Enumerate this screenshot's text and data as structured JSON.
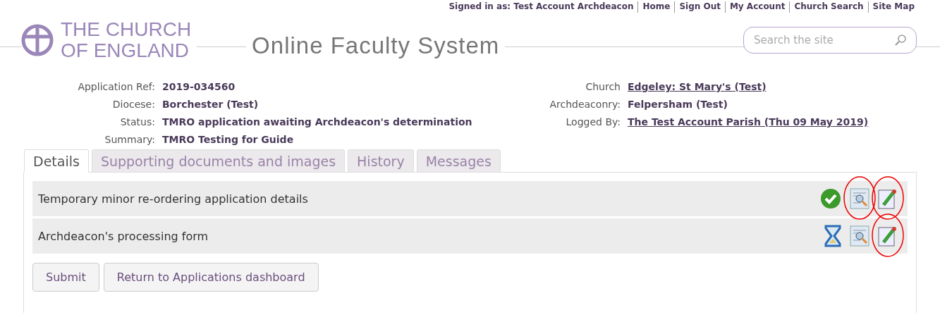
{
  "top_links": [
    "Signed in as: Test Account Archdeacon",
    "Home",
    "Sign Out",
    "My Account",
    "Church Search",
    "Site Map"
  ],
  "logo": {
    "line1": "THE CHURCH",
    "line2": "OF ENGLAND"
  },
  "site_title": "Online Faculty System",
  "search": {
    "placeholder": "Search the site"
  },
  "details_left": [
    {
      "label": "Application Ref:",
      "value": "2019-034560",
      "link": false
    },
    {
      "label": "Diocese:",
      "value": "Borchester (Test)",
      "link": false
    },
    {
      "label": "Status:",
      "value": "TMRO application awaiting Archdeacon's determination",
      "link": false
    },
    {
      "label": "Summary:",
      "value": "TMRO Testing for Guide",
      "link": false
    }
  ],
  "details_right": [
    {
      "label": "Church",
      "value": "Edgeley: St Mary's (Test)",
      "link": true
    },
    {
      "label": "Archdeaconry:",
      "value": "Felpersham (Test)",
      "link": false
    },
    {
      "label": "Logged By:",
      "value": "The Test Account Parish (Thu 09 May 2019)",
      "link": true
    }
  ],
  "tabs": [
    {
      "label": "Details",
      "selected": true
    },
    {
      "label": "Supporting documents and images",
      "selected": false
    },
    {
      "label": "History",
      "selected": false
    },
    {
      "label": "Messages",
      "selected": false
    }
  ],
  "forms": [
    {
      "title": "Temporary minor re-ordering application details",
      "kind": "complete",
      "view_circled": true,
      "edit_circled": true
    },
    {
      "title": "Archdeacon's processing form",
      "kind": "pending",
      "view_circled": false,
      "edit_circled": true
    }
  ],
  "buttons": [
    "Submit",
    "Return to Applications dashboard"
  ]
}
